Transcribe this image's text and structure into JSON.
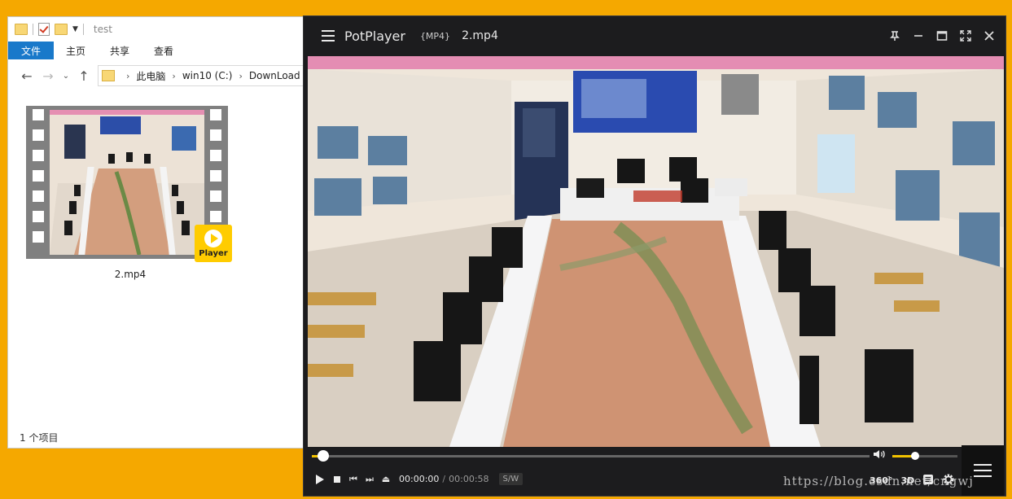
{
  "explorer": {
    "title": "test",
    "ribbon_tabs": [
      "文件",
      "主页",
      "共享",
      "查看"
    ],
    "breadcrumb": [
      "此电脑",
      "win10 (C:)",
      "DownLoad"
    ],
    "file": {
      "name": "2.mp4",
      "badge_label": "Player"
    },
    "status": "1 个项目"
  },
  "potplayer": {
    "app_name": "PotPlayer",
    "format": "{MP4}",
    "file_name": "2.mp4",
    "current_time": "00:00:00",
    "time_separator": "/",
    "total_time": "00:00:58",
    "sw_label": "S/W",
    "btn_360": "360°",
    "btn_3d": "3D",
    "playback_progress": 0.02,
    "volume_level": 0.35
  },
  "watermark": "https://blog.csdn.net/cngwj",
  "colors": {
    "desktop": "#f5a800",
    "accent": "#f2c200",
    "ribbon_active": "#1979ca",
    "badge": "#ffcc00"
  }
}
